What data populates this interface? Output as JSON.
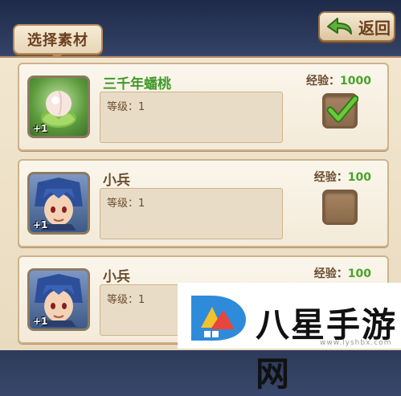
{
  "header": {
    "title": "选择素材",
    "back_label": "返回"
  },
  "items": [
    {
      "name": "三千年蟠桃",
      "level_label": "等级：1",
      "exp_label": "经验：",
      "exp_value": "1000",
      "badge": "+1",
      "selected": true,
      "name_color": "#3f9a2a",
      "icon": "peach-icon"
    },
    {
      "name": "小兵",
      "level_label": "等级：1",
      "exp_label": "经验：",
      "exp_value": "100",
      "badge": "+1",
      "selected": false,
      "name_color": "#6b4c2e",
      "icon": "soldier-portrait"
    },
    {
      "name": "小兵",
      "level_label": "等级：1",
      "exp_label": "经验：",
      "exp_value": "100",
      "badge": "+1",
      "selected": false,
      "name_color": "#6b4c2e",
      "icon": "soldier-portrait"
    }
  ],
  "watermark": {
    "text": "八星手游网",
    "url": "www.lyshbx.com"
  }
}
